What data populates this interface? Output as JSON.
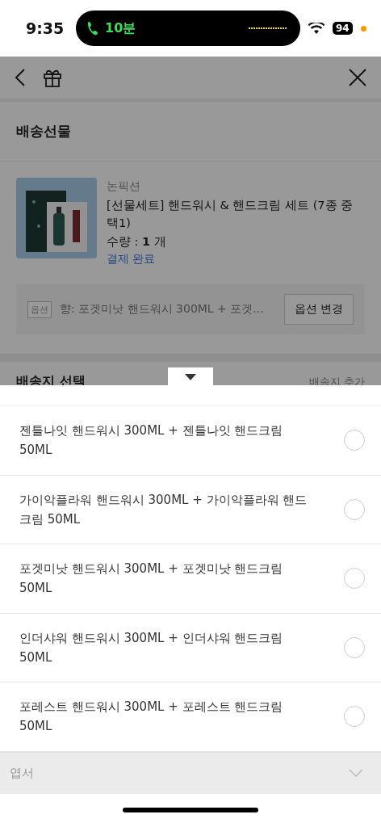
{
  "status_bar": {
    "time": "9:35",
    "call_duration": "10분",
    "battery": "94"
  },
  "section_title": "배송선물",
  "product": {
    "brand": "논픽션",
    "name": "[선물세트] 핸드워시 & 핸드크림 세트 (7종 중 택1)",
    "quantity_label": "수량 : ",
    "quantity": "1",
    "quantity_unit": " 개",
    "status": "결제 완료"
  },
  "option": {
    "tag": "옵션",
    "value": "향: 포겟미낫 핸드워시 300ML + 포겟...",
    "button": "옵션 변경"
  },
  "address_section": {
    "title": "배송지 선택",
    "action": "배송지 추가"
  },
  "sheet": {
    "options": [
      {
        "label": "젠틀나잇 핸드워시 300ML + 젠틀나잇 핸드크림 50ML",
        "selected": false
      },
      {
        "label": "가이악플라워 핸드워시 300ML + 가이악플라워 핸드크림 50ML",
        "selected": false
      },
      {
        "label": "포겟미낫 핸드워시 300ML + 포겟미낫 핸드크림 50ML",
        "selected": false
      },
      {
        "label": "인더샤워 핸드워시 300ML + 인더샤워 핸드크림 50ML",
        "selected": false
      },
      {
        "label": "포레스트 핸드워시 300ML + 포레스트 핸드크림 50ML",
        "selected": false
      }
    ],
    "next_section": {
      "label": "엽서",
      "expanded": false
    }
  }
}
